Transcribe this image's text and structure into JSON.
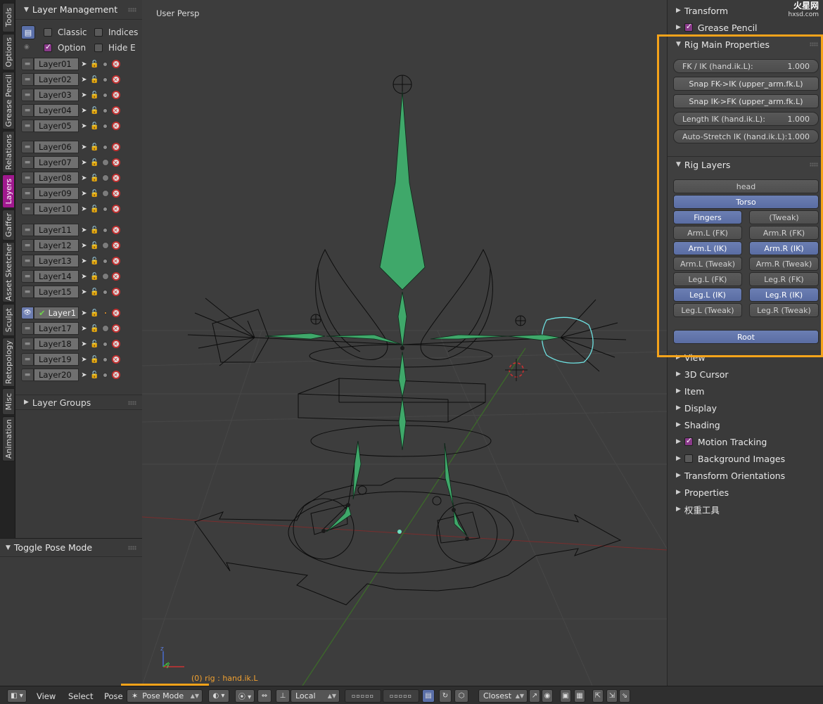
{
  "vertical_tabs": [
    "Tools",
    "Options",
    "Grease Pencil",
    "Relations",
    "Layers",
    "Gaffer",
    "Asset Sketcher",
    "Sculpt",
    "Retopology",
    "Misc",
    "Animation"
  ],
  "layer_management": {
    "title": "Layer Management",
    "options": {
      "classic": "Classic",
      "indices": "Indices",
      "option": "Option",
      "hide_e": "Hide E"
    },
    "layers": [
      "Layer01",
      "Layer02",
      "Layer03",
      "Layer04",
      "Layer05",
      "Layer06",
      "Layer07",
      "Layer08",
      "Layer09",
      "Layer10",
      "Layer11",
      "Layer12",
      "Layer13",
      "Layer14",
      "Layer15",
      "Layer1",
      "Layer17",
      "Layer18",
      "Layer19",
      "Layer20"
    ],
    "layer_groups": "Layer Groups"
  },
  "toggle_pose_mode": "Toggle Pose Mode",
  "viewport": {
    "label": "User Persp",
    "status": "(0) rig : hand.ik.L",
    "axis_z": "z",
    "axis_y": "y"
  },
  "right_panel": {
    "transform": "Transform",
    "grease_pencil": "Grease Pencil",
    "rig_main": {
      "title": "Rig Main Properties",
      "fk_ik_label": "FK / IK (hand.ik.L):",
      "fk_ik_value": "1.000",
      "snap_fk_ik": "Snap FK->IK (upper_arm.fk.L)",
      "snap_ik_fk": "Snap IK->FK (upper_arm.fk.L)",
      "length_ik_label": "Length IK (hand.ik.L):",
      "length_ik_value": "1.000",
      "auto_stretch_label": "Auto-Stretch IK (hand.ik.L):",
      "auto_stretch_value": "1.000"
    },
    "rig_layers": {
      "title": "Rig Layers",
      "head": "head",
      "torso": "Torso",
      "fingers": "Fingers",
      "tweak": "(Tweak)",
      "arm_l_fk": "Arm.L (FK)",
      "arm_r_fk": "Arm.R (FK)",
      "arm_l_ik": "Arm.L (IK)",
      "arm_r_ik": "Arm.R (IK)",
      "arm_l_tweak": "Arm.L (Tweak)",
      "arm_r_tweak": "Arm.R (Tweak)",
      "leg_l_fk": "Leg.L (FK)",
      "leg_r_fk": "Leg.R (FK)",
      "leg_l_ik": "Leg.L (IK)",
      "leg_r_ik": "Leg.R (IK)",
      "leg_l_tweak": "Leg.L (Tweak)",
      "leg_r_tweak": "Leg.R (Tweak)",
      "root": "Root"
    },
    "sections": [
      "View",
      "3D Cursor",
      "Item",
      "Display",
      "Shading",
      "Motion Tracking",
      "Background Images",
      "Transform Orientations",
      "Properties",
      "权重工具"
    ]
  },
  "bottom_bar": {
    "view": "View",
    "select": "Select",
    "pose": "Pose",
    "mode": "Pose Mode",
    "orientation": "Local",
    "snap": "Closest"
  },
  "watermark": {
    "brand": "火星网",
    "site": "hxsd.com"
  },
  "colors": {
    "accent_purple": "#a0198e",
    "highlight_orange": "#f5a31a",
    "button_on": "#6b7fb3",
    "bone_green": "#3fa86a"
  }
}
